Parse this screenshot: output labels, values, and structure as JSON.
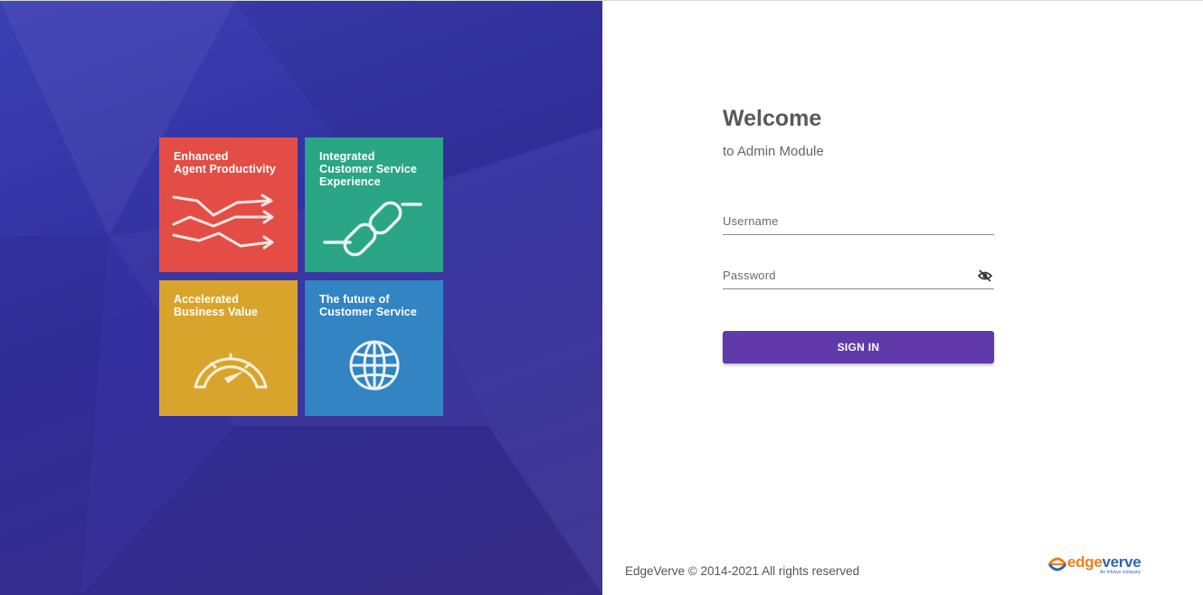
{
  "brand_colors": {
    "left_panel": "#3336a6",
    "tile_productivity": "#e44d45",
    "tile_experience": "#2aa585",
    "tile_value": "#d9a42b",
    "tile_future": "#3284c2",
    "signin_button": "#5f3aa8",
    "logo_orange": "#f07d1b",
    "logo_blue": "#2a67b0"
  },
  "tiles": [
    {
      "title": "Enhanced\nAgent Productivity",
      "icon": "trend-arrows-icon"
    },
    {
      "title": "Integrated\nCustomer Service\nExperience",
      "icon": "chain-link-icon"
    },
    {
      "title": "Accelerated\nBusiness Value",
      "icon": "speedometer-icon"
    },
    {
      "title": "The future of\nCustomer Service",
      "icon": "globe-icon"
    }
  ],
  "login": {
    "welcome": "Welcome",
    "subtitle": "to Admin Module",
    "username_placeholder": "Username",
    "password_placeholder": "Password",
    "password_toggle_icon": "eye-off-icon",
    "signin_label": "SIGN IN"
  },
  "footer": {
    "copyright": "EdgeVerve © 2014-2021 All rights reserved",
    "logo_edge": "edge",
    "logo_verve": "verve",
    "logo_tagline": "An Infosys company"
  }
}
